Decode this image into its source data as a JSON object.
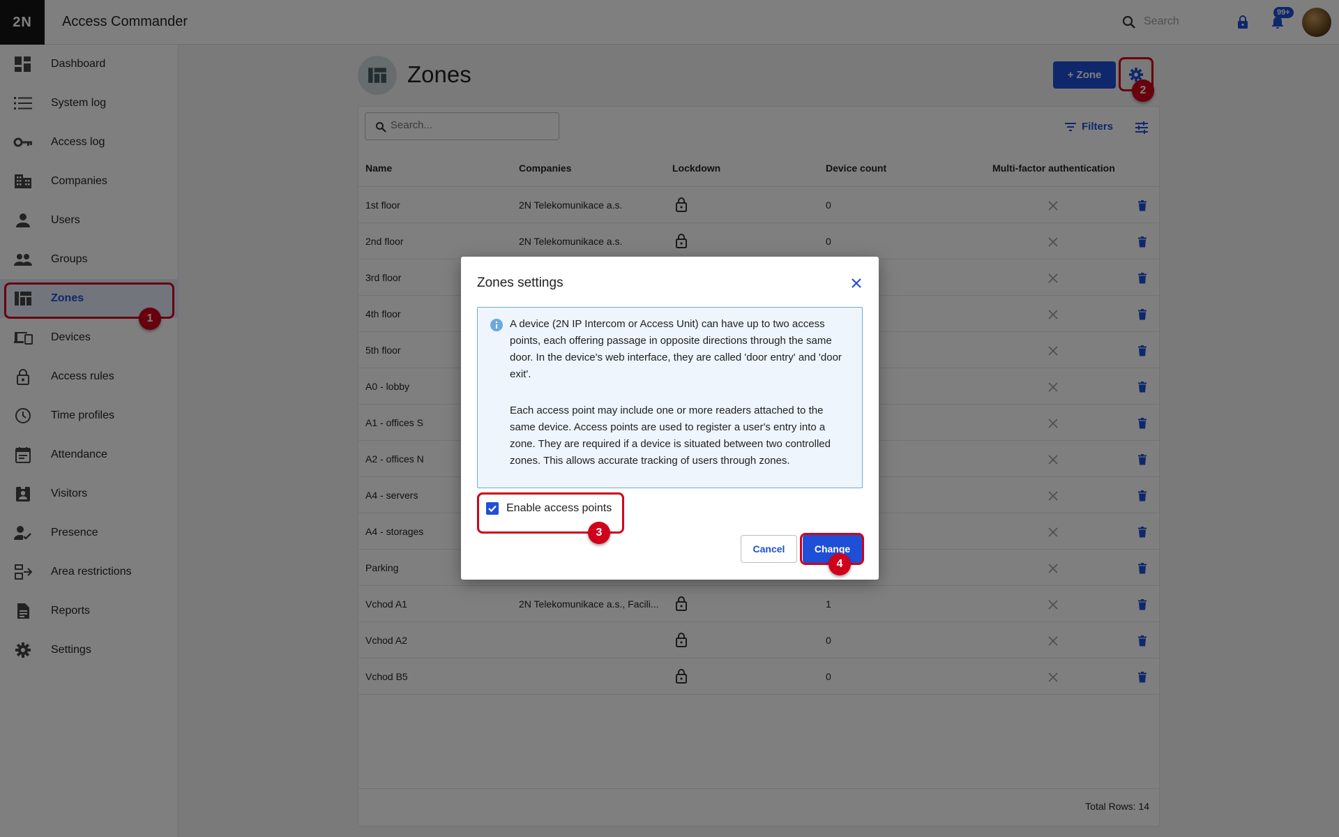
{
  "app": {
    "logo": "2N",
    "title": "Access Commander"
  },
  "topbar": {
    "search_placeholder": "Search",
    "notification_badge": "99+"
  },
  "sidebar": {
    "items": [
      {
        "label": "Dashboard",
        "icon": "dashboard-icon"
      },
      {
        "label": "System log",
        "icon": "list-icon"
      },
      {
        "label": "Access log",
        "icon": "key-icon"
      },
      {
        "label": "Companies",
        "icon": "building-icon"
      },
      {
        "label": "Users",
        "icon": "person-icon"
      },
      {
        "label": "Groups",
        "icon": "people-icon"
      },
      {
        "label": "Zones",
        "icon": "zones-icon",
        "active": true
      },
      {
        "label": "Devices",
        "icon": "devices-icon"
      },
      {
        "label": "Access rules",
        "icon": "lock-icon"
      },
      {
        "label": "Time profiles",
        "icon": "clock-icon"
      },
      {
        "label": "Attendance",
        "icon": "calendar-icon"
      },
      {
        "label": "Visitors",
        "icon": "badge-icon"
      },
      {
        "label": "Presence",
        "icon": "person-check-icon"
      },
      {
        "label": "Area restrictions",
        "icon": "area-icon"
      },
      {
        "label": "Reports",
        "icon": "document-icon"
      },
      {
        "label": "Settings",
        "icon": "gear-icon"
      }
    ]
  },
  "page": {
    "title": "Zones",
    "add_button": "Zone"
  },
  "table": {
    "search_placeholder": "Search...",
    "filters_label": "Filters",
    "columns": [
      "Name",
      "Companies",
      "Lockdown",
      "Device count",
      "Multi-factor authentication"
    ],
    "rows": [
      {
        "name": "1st floor",
        "company": "2N Telekomunikace a.s.",
        "devices": "0"
      },
      {
        "name": "2nd floor",
        "company": "2N Telekomunikace a.s.",
        "devices": "0"
      },
      {
        "name": "3rd floor",
        "company": "",
        "devices": ""
      },
      {
        "name": "4th floor",
        "company": "",
        "devices": ""
      },
      {
        "name": "5th floor",
        "company": "",
        "devices": ""
      },
      {
        "name": "A0 - lobby",
        "company": "",
        "devices": ""
      },
      {
        "name": "A1 - offices S",
        "company": "",
        "devices": ""
      },
      {
        "name": "A2 - offices N",
        "company": "",
        "devices": ""
      },
      {
        "name": "A4 - servers",
        "company": "",
        "devices": ""
      },
      {
        "name": "A4 - storages",
        "company": "",
        "devices": ""
      },
      {
        "name": "Parking",
        "company": "",
        "devices": ""
      },
      {
        "name": "Vchod A1",
        "company": "2N Telekomunikace a.s., Facili...",
        "devices": "1"
      },
      {
        "name": "Vchod A2",
        "company": "",
        "devices": "0"
      },
      {
        "name": "Vchod B5",
        "company": "",
        "devices": "0"
      }
    ],
    "total_rows": "Total Rows: 14"
  },
  "modal": {
    "title": "Zones settings",
    "paragraph1": "A device (2N IP Intercom or Access Unit) can have up to two access points, each offering passage in opposite directions through the same door. In the device's web interface, they are called 'door entry' and 'door exit'.",
    "paragraph2": "Each access point may include one or more readers attached to the same device. Access points are used to register a user's entry into a zone. They are required if a device is situated between two controlled zones. This allows accurate tracking of users through zones.",
    "checkbox_label": "Enable access points",
    "checkbox_checked": true,
    "cancel": "Cancel",
    "change": "Change"
  },
  "annotations": {
    "step1": "1",
    "step2": "2",
    "step3": "3",
    "step4": "4"
  },
  "colors": {
    "primary": "#1f4fd6",
    "annotation": "#d0021b",
    "info_border": "#6fa8dc"
  }
}
